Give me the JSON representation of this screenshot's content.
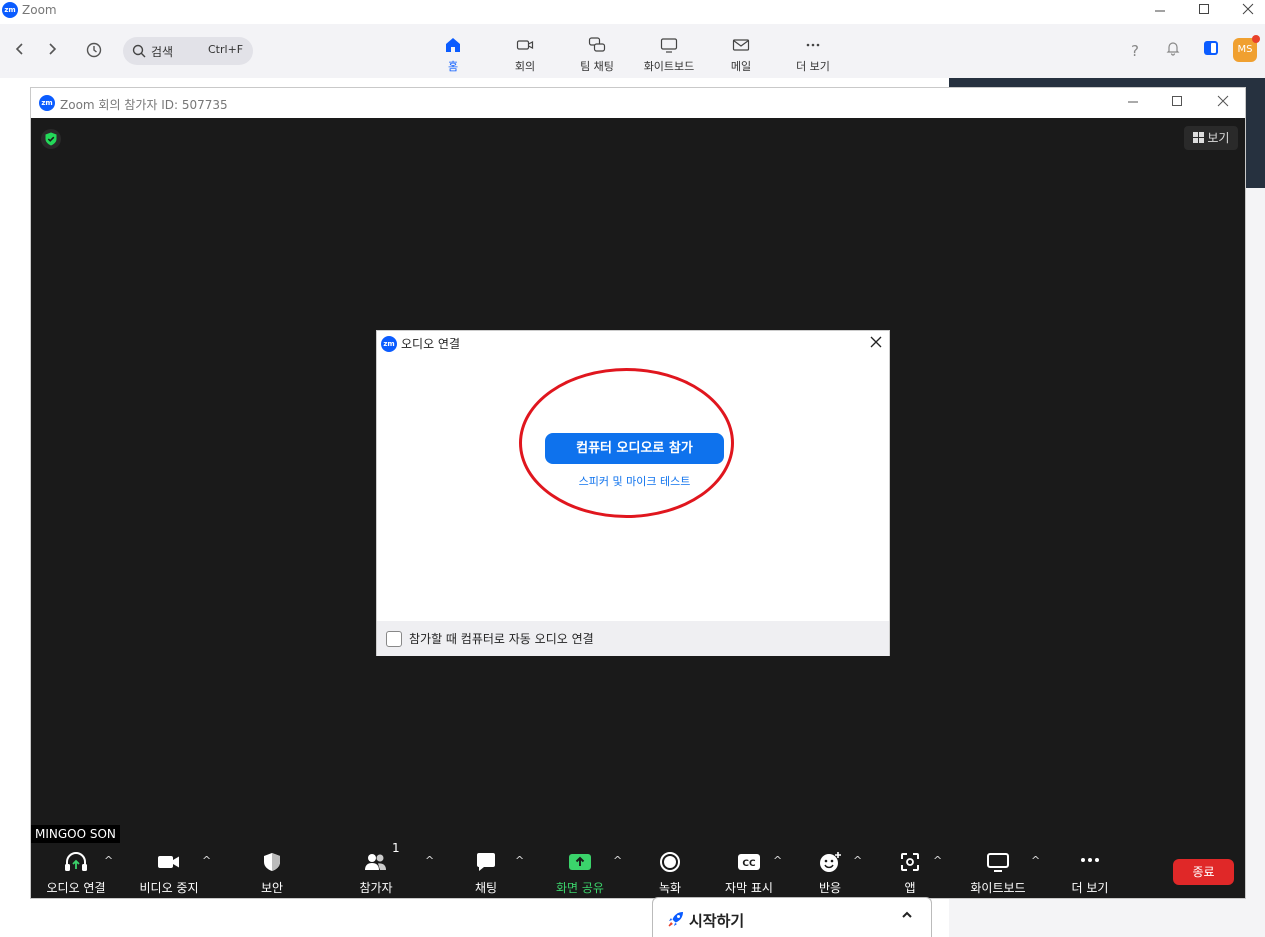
{
  "app": {
    "title": "Zoom",
    "logo_text": "zm"
  },
  "window_controls": {
    "minimize": "—",
    "maximize": "☐",
    "close": "✕"
  },
  "toolbar": {
    "search_label": "검색",
    "search_shortcut": "Ctrl+F",
    "tabs": [
      {
        "label": "홈",
        "icon": "home-icon",
        "active": true
      },
      {
        "label": "회의",
        "icon": "video-camera-icon"
      },
      {
        "label": "팀 채팅",
        "icon": "chat-bubbles-icon"
      },
      {
        "label": "화이트보드",
        "icon": "whiteboard-icon"
      },
      {
        "label": "메일",
        "icon": "mail-icon"
      },
      {
        "label": "더 보기",
        "icon": "more-icon"
      }
    ],
    "help_icon": "?",
    "avatar_initials": "MS"
  },
  "meeting": {
    "window_title": "Zoom 회의 참가자 ID: 507735",
    "view_button": "보기",
    "participant_name": "MINGOO SON",
    "controls": [
      {
        "label": "오디오 연결",
        "icon": "headphones-icon",
        "caret": true
      },
      {
        "label": "비디오 중지",
        "icon": "video-camera-icon",
        "caret": true
      },
      {
        "label": "보안",
        "icon": "shield-icon",
        "caret": false
      },
      {
        "label": "참가자",
        "icon": "participants-icon",
        "count": "1",
        "caret": true
      },
      {
        "label": "채팅",
        "icon": "chat-icon",
        "caret": true
      },
      {
        "label": "화면 공유",
        "icon": "share-screen-icon",
        "caret": true,
        "highlight": "#3bd36b"
      },
      {
        "label": "녹화",
        "icon": "record-icon",
        "caret": false
      },
      {
        "label": "자막 표시",
        "icon": "captions-icon",
        "caret": true
      },
      {
        "label": "반응",
        "icon": "reaction-icon",
        "caret": true
      },
      {
        "label": "앱",
        "icon": "apps-icon",
        "caret": true
      },
      {
        "label": "화이트보드",
        "icon": "whiteboard-icon",
        "caret": true
      },
      {
        "label": "더 보기",
        "icon": "more-icon",
        "caret": false
      }
    ],
    "end_button": "종료"
  },
  "audio_dialog": {
    "title": "오디오 연결",
    "join_button": "컴퓨터 오디오로 참가",
    "test_link": "스피커 및 마이크 테스트",
    "auto_connect_label": "참가할 때 컴퓨터로 자동 오디오 연결",
    "auto_connect_checked": false,
    "highlight_color": "#e0161e"
  },
  "getting_started": {
    "label": "시작하기",
    "chevron": "⌃"
  },
  "colors": {
    "accent": "#0b5cff",
    "button_blue": "#0e72ed",
    "end_red": "#e02828",
    "share_green": "#3bd36b"
  }
}
